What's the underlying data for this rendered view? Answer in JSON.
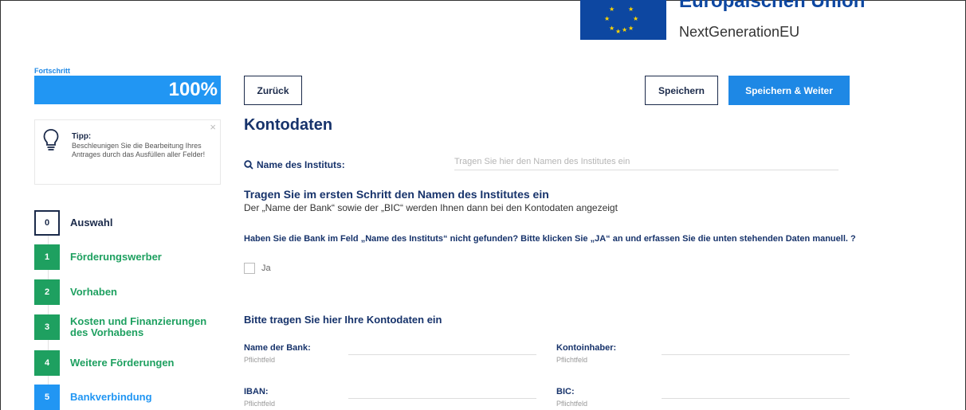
{
  "header": {
    "eu_title": "Europäischen Union",
    "eu_subtitle": "NextGenerationEU"
  },
  "progress": {
    "label": "Fortschritt",
    "value_text": "100%",
    "value": 1.0
  },
  "tip": {
    "title": "Tipp:",
    "text": "Beschleunigen Sie die Bearbeitung Ihres Antrages durch das Ausfüllen aller Felder!",
    "close": "×"
  },
  "steps": [
    {
      "num": "0",
      "label": "Auswahl"
    },
    {
      "num": "1",
      "label": "Förderungswerber"
    },
    {
      "num": "2",
      "label": "Vorhaben"
    },
    {
      "num": "3",
      "label": "Kosten und Finanzierungen des Vorhabens"
    },
    {
      "num": "4",
      "label": "Weitere Förderungen"
    },
    {
      "num": "5",
      "label": "Bankverbindung"
    }
  ],
  "toolbar": {
    "back": "Zurück",
    "save": "Speichern",
    "save_next": "Speichern & Weiter"
  },
  "main": {
    "title": "Kontodaten",
    "search_label": "Name des Instituts:",
    "search_placeholder": "Tragen Sie hier den Namen des Institutes ein",
    "heading": "Tragen Sie im ersten Schritt den Namen des Institutes ein",
    "info": "Der „Name der Bank“ sowie der „BIC“ werden Ihnen dann bei den Kontodaten angezeigt",
    "question": "Haben Sie die Bank im Feld „Name des Instituts“ nicht gefunden? Bitte klicken Sie „JA“ an und erfassen Sie die unten stehenden Daten manuell. ?",
    "checkbox_label": "Ja",
    "account_heading": "Bitte tragen Sie hier Ihre Kontodaten ein"
  },
  "fields": {
    "bank_name": {
      "label": "Name der Bank:",
      "sub": "Pflichtfeld",
      "value": ""
    },
    "account_holder": {
      "label": "Kontoinhaber:",
      "sub": "Pflichtfeld",
      "value": ""
    },
    "iban": {
      "label": "IBAN:",
      "sub": "Pflichtfeld",
      "value": ""
    },
    "bic": {
      "label": "BIC:",
      "sub": "Pflichtfeld",
      "value": ""
    }
  }
}
